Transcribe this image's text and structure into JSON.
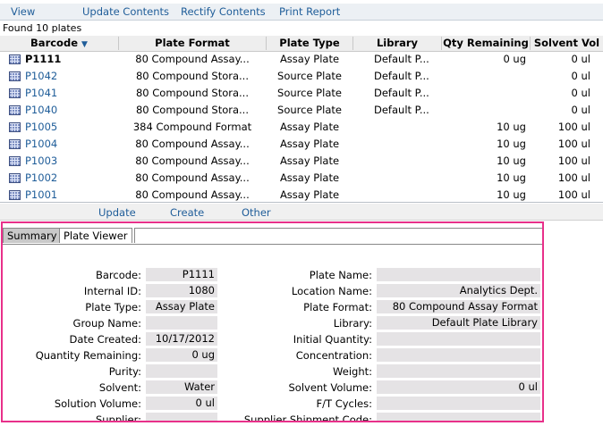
{
  "menu": [
    "View",
    "Update Contents",
    "Rectify Contents",
    "Print Report"
  ],
  "found_text": "Found 10 plates",
  "columns": [
    "Barcode",
    "Plate Format",
    "Plate Type",
    "Library",
    "Qty Remaining",
    "Solvent Vol"
  ],
  "rows": [
    {
      "barcode": "P1111",
      "format": "80 Compound Assay...",
      "type": "Assay Plate",
      "library": "Default P...",
      "qty": "0 ug",
      "solvent": "0 ul"
    },
    {
      "barcode": "P1042",
      "format": "80 Compound Stora...",
      "type": "Source Plate",
      "library": "Default P...",
      "qty": "",
      "solvent": "0 ul"
    },
    {
      "barcode": "P1041",
      "format": "80 Compound Stora...",
      "type": "Source Plate",
      "library": "Default P...",
      "qty": "",
      "solvent": "0 ul"
    },
    {
      "barcode": "P1040",
      "format": "80 Compound Stora...",
      "type": "Source Plate",
      "library": "Default P...",
      "qty": "",
      "solvent": "0 ul"
    },
    {
      "barcode": "P1005",
      "format": "384 Compound Format",
      "type": "Assay Plate",
      "library": "",
      "qty": "10 ug",
      "solvent": "100 ul"
    },
    {
      "barcode": "P1004",
      "format": "80 Compound Assay...",
      "type": "Assay Plate",
      "library": "",
      "qty": "10 ug",
      "solvent": "100 ul"
    },
    {
      "barcode": "P1003",
      "format": "80 Compound Assay...",
      "type": "Assay Plate",
      "library": "",
      "qty": "10 ug",
      "solvent": "100 ul"
    },
    {
      "barcode": "P1002",
      "format": "80 Compound Assay...",
      "type": "Assay Plate",
      "library": "",
      "qty": "10 ug",
      "solvent": "100 ul"
    },
    {
      "barcode": "P1001",
      "format": "80 Compound Assay...",
      "type": "Assay Plate",
      "library": "",
      "qty": "10 ug",
      "solvent": "100 ul"
    }
  ],
  "actions": [
    "Update",
    "Create",
    "Other"
  ],
  "tabs": [
    "Summary",
    "Plate Viewer"
  ],
  "left_fields": [
    {
      "label": "Barcode:",
      "value": "P1111"
    },
    {
      "label": "Internal ID:",
      "value": "1080"
    },
    {
      "label": "Plate Type:",
      "value": "Assay Plate"
    },
    {
      "label": "Group Name:",
      "value": ""
    },
    {
      "label": "Date Created:",
      "value": "10/17/2012"
    },
    {
      "label": "Quantity Remaining:",
      "value": "0 ug"
    },
    {
      "label": "Purity:",
      "value": ""
    },
    {
      "label": "Solvent:",
      "value": "Water"
    },
    {
      "label": "Solution Volume:",
      "value": "0 ul"
    },
    {
      "label": "Supplier:",
      "value": ""
    }
  ],
  "right_fields": [
    {
      "label": "Plate Name:",
      "value": ""
    },
    {
      "label": "Location Name:",
      "value": "Analytics Dept."
    },
    {
      "label": "Plate Format:",
      "value": "80 Compound Assay Format"
    },
    {
      "label": "Library:",
      "value": "Default Plate Library"
    },
    {
      "label": "Initial Quantity:",
      "value": ""
    },
    {
      "label": "Concentration:",
      "value": ""
    },
    {
      "label": "Weight:",
      "value": ""
    },
    {
      "label": "Solvent Volume:",
      "value": "0 ul"
    },
    {
      "label": "F/T Cycles:",
      "value": ""
    },
    {
      "label": "Supplier Shipment Code:",
      "value": ""
    }
  ],
  "colors": {
    "link": "#1f5d99",
    "highlight": "#e8308a",
    "field_bg": "#e5e3e5"
  },
  "icons": {
    "sort": "sort-down-icon",
    "plate": "plate-icon"
  }
}
